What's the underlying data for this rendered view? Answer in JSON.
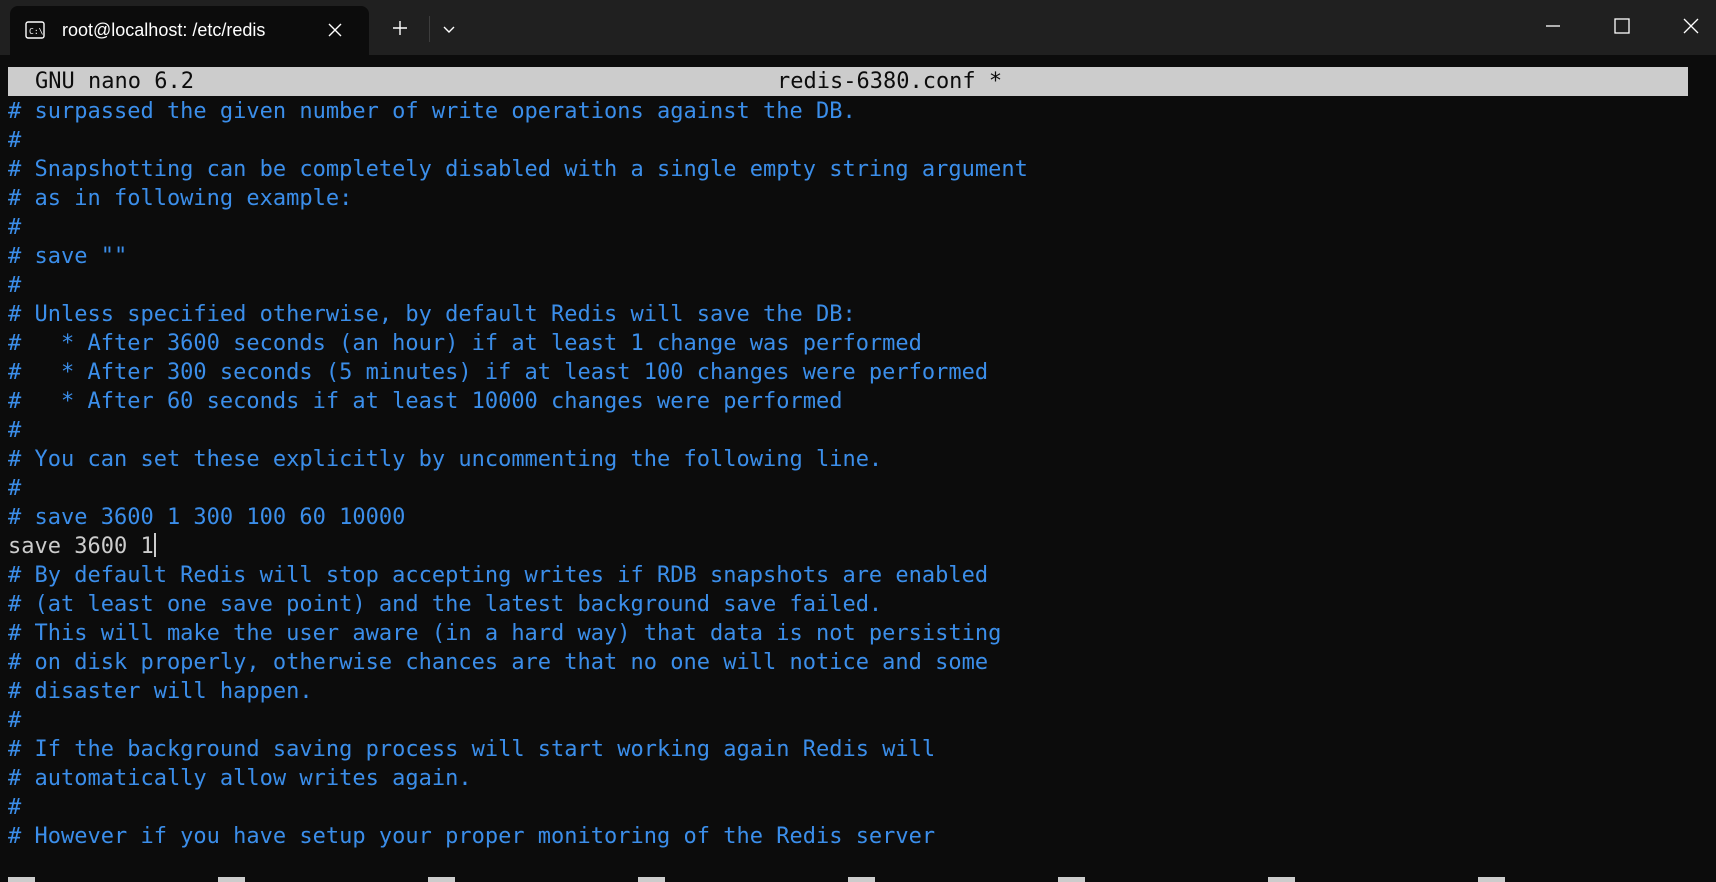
{
  "window": {
    "tab_title": "root@localhost: /etc/redis",
    "tab_icon": "terminal-icon",
    "controls": [
      "minimize-icon",
      "maximize-icon",
      "close-icon"
    ]
  },
  "colors": {
    "titlebar_bg": "#202020",
    "terminal_bg": "#0c0c0c",
    "comment": "#3b8eea",
    "text": "#cccccc",
    "header_bg": "#cccccc"
  },
  "nano": {
    "version": "GNU nano 6.2",
    "filename": "redis-6380.conf *"
  },
  "editor": {
    "lines": [
      {
        "text": "# surpassed the given number of write operations against the DB.",
        "comment": true
      },
      {
        "text": "#",
        "comment": true
      },
      {
        "text": "# Snapshotting can be completely disabled with a single empty string argument",
        "comment": true
      },
      {
        "text": "# as in following example:",
        "comment": true
      },
      {
        "text": "#",
        "comment": true
      },
      {
        "text": "# save \"\"",
        "comment": true
      },
      {
        "text": "#",
        "comment": true
      },
      {
        "text": "# Unless specified otherwise, by default Redis will save the DB:",
        "comment": true
      },
      {
        "text": "#   * After 3600 seconds (an hour) if at least 1 change was performed",
        "comment": true
      },
      {
        "text": "#   * After 300 seconds (5 minutes) if at least 100 changes were performed",
        "comment": true
      },
      {
        "text": "#   * After 60 seconds if at least 10000 changes were performed",
        "comment": true
      },
      {
        "text": "#",
        "comment": true
      },
      {
        "text": "# You can set these explicitly by uncommenting the following line.",
        "comment": true
      },
      {
        "text": "#",
        "comment": true
      },
      {
        "text": "# save 3600 1 300 100 60 10000",
        "comment": true
      },
      {
        "text": "save 3600 1",
        "comment": false,
        "cursor": true
      },
      {
        "text": "# By default Redis will stop accepting writes if RDB snapshots are enabled",
        "comment": true
      },
      {
        "text": "# (at least one save point) and the latest background save failed.",
        "comment": true
      },
      {
        "text": "# This will make the user aware (in a hard way) that data is not persisting",
        "comment": true
      },
      {
        "text": "# on disk properly, otherwise chances are that no one will notice and some",
        "comment": true
      },
      {
        "text": "# disaster will happen.",
        "comment": true
      },
      {
        "text": "#",
        "comment": true
      },
      {
        "text": "# If the background saving process will start working again Redis will",
        "comment": true
      },
      {
        "text": "# automatically allow writes again.",
        "comment": true
      },
      {
        "text": "#",
        "comment": true
      },
      {
        "text": "# However if you have setup your proper monitoring of the Redis server",
        "comment": true
      }
    ]
  }
}
